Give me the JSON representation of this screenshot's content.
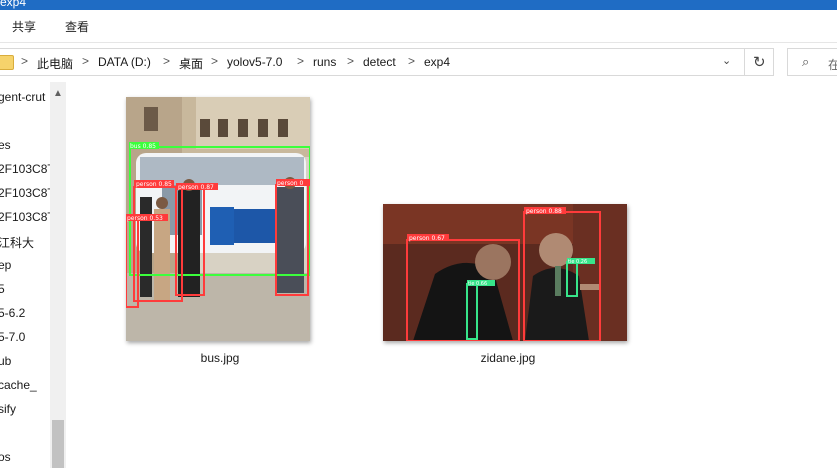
{
  "window": {
    "title": "exp4"
  },
  "ribbon": {
    "tabs": [
      "共享",
      "查看"
    ]
  },
  "address": {
    "crumbs": [
      "此电脑",
      "DATA (D:)",
      "桌面",
      "yolov5-7.0",
      "runs",
      "detect",
      "exp4"
    ],
    "separator": ">",
    "dropdown_glyph": "⌄",
    "refresh_glyph": "↻"
  },
  "search": {
    "glyph": "⌕",
    "placeholder": "在"
  },
  "nav": {
    "items": [
      "gent-crut",
      "es",
      "2F103C8T",
      "2F103C8T",
      "2F103C8T",
      "江科大",
      "ep",
      "5",
      "5-6.2",
      "5-7.0",
      "ub",
      "cache_",
      "sify",
      "os"
    ],
    "scroll_up_glyph": "▲"
  },
  "files": [
    {
      "name": "bus.jpg",
      "detections": [
        {
          "label": "bus 0.85"
        },
        {
          "label": "person 0.85"
        },
        {
          "label": "person 0.87"
        },
        {
          "label": "person 0.53"
        },
        {
          "label": "person 0"
        }
      ]
    },
    {
      "name": "zidane.jpg",
      "detections": [
        {
          "label": "person 0.67"
        },
        {
          "label": "person 0.88"
        },
        {
          "label": "tie 0.66"
        },
        {
          "label": "tie 0.26"
        }
      ]
    }
  ],
  "colors": {
    "titlebar": "#1f6cc4",
    "box_person": "#ff3b3b",
    "box_bus": "#3cff3c",
    "box_tie": "#37e58a",
    "scroll_track": "#f0f0f0",
    "scroll_thumb": "#c2c2c2"
  }
}
